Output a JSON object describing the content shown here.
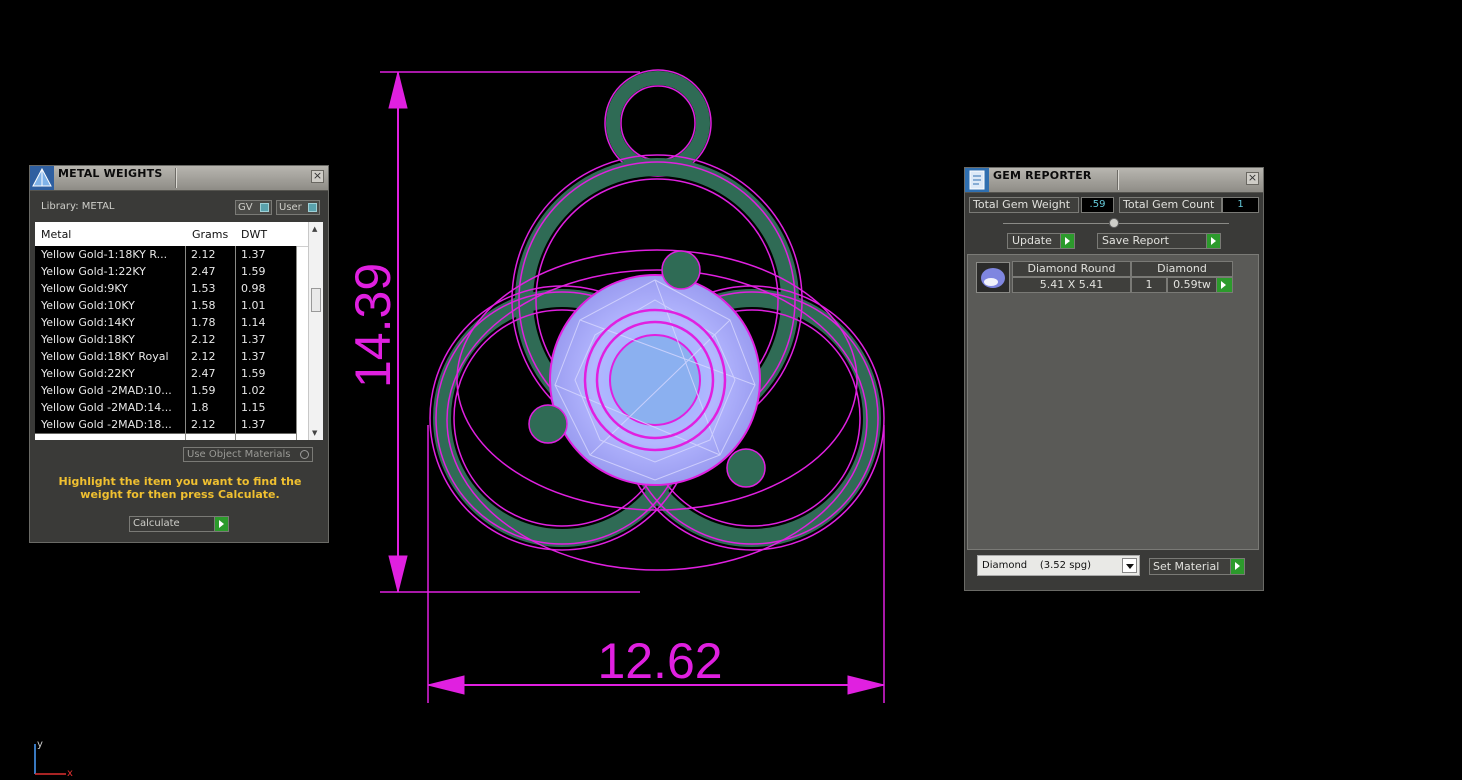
{
  "colors": {
    "dimension": "#e020e0",
    "metal": "#2f6b55",
    "gem": "#b0b0ff",
    "hint": "#f0c030",
    "accent_value": "#64c8d8"
  },
  "dimensions": {
    "height": "14.39",
    "width": "12.62"
  },
  "metal_panel": {
    "title": "METAL WEIGHTS",
    "library": "Library: METAL",
    "toggle_gv": "GV",
    "toggle_user": "User",
    "columns": [
      "Metal",
      "Grams",
      "DWT"
    ],
    "rows": [
      {
        "metal": "Yellow Gold-1:18KY R...",
        "grams": "2.12",
        "dwt": "1.37"
      },
      {
        "metal": "Yellow Gold-1:22KY",
        "grams": "2.47",
        "dwt": "1.59"
      },
      {
        "metal": "Yellow Gold:9KY",
        "grams": "1.53",
        "dwt": "0.98"
      },
      {
        "metal": "Yellow Gold:10KY",
        "grams": "1.58",
        "dwt": "1.01"
      },
      {
        "metal": "Yellow Gold:14KY",
        "grams": "1.78",
        "dwt": "1.14"
      },
      {
        "metal": "Yellow Gold:18KY",
        "grams": "2.12",
        "dwt": "1.37"
      },
      {
        "metal": "Yellow Gold:18KY Royal",
        "grams": "2.12",
        "dwt": "1.37"
      },
      {
        "metal": "Yellow Gold:22KY",
        "grams": "2.47",
        "dwt": "1.59"
      },
      {
        "metal": "Yellow Gold -2MAD:10...",
        "grams": "1.59",
        "dwt": "1.02"
      },
      {
        "metal": "Yellow Gold -2MAD:14...",
        "grams": "1.8",
        "dwt": "1.15"
      },
      {
        "metal": "Yellow Gold -2MAD:18...",
        "grams": "2.12",
        "dwt": "1.37"
      }
    ],
    "use_object_materials": "Use Object Materials",
    "hint": "Highlight the item you want to find the weight for then press Calculate.",
    "calculate": "Calculate"
  },
  "gem_panel": {
    "title": "GEM REPORTER",
    "total_weight_label": "Total Gem Weight",
    "total_weight_value": ".59",
    "total_count_label": "Total Gem Count",
    "total_count_value": "1",
    "update": "Update",
    "save_report": "Save Report",
    "gem": {
      "shape": "Diamond Round",
      "material": "Diamond",
      "size": "5.41 X 5.41",
      "count": "1",
      "weight": "0.59tw"
    },
    "material_select": "Diamond    (3.52 spg)",
    "set_material": "Set Material"
  },
  "axes": {
    "y": "y",
    "x": "x"
  }
}
